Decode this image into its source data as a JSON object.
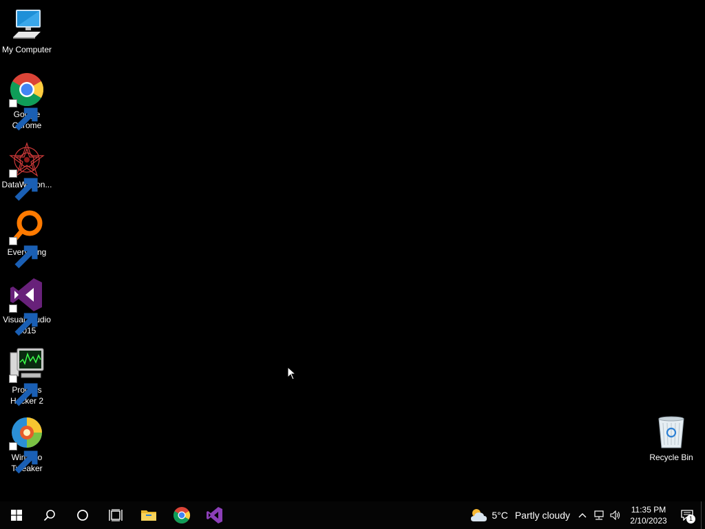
{
  "desktop_icons": [
    {
      "label": "My Computer",
      "icon": "computer-icon"
    },
    {
      "label": "Google Chrome",
      "icon": "chrome-icon"
    },
    {
      "label": "DataWagon...",
      "icon": "datawagon-icon"
    },
    {
      "label": "Everything",
      "icon": "everything-search-icon"
    },
    {
      "label": "Visual Studio 2015",
      "icon": "visual-studio-icon"
    },
    {
      "label": "Process Hacker 2",
      "icon": "process-hacker-icon"
    },
    {
      "label": "Winaero Tweaker",
      "icon": "winaero-tweaker-icon"
    }
  ],
  "recycle_bin": {
    "label": "Recycle Bin",
    "icon": "recycle-bin-icon"
  },
  "taskbar": {
    "start": "windows-start-icon",
    "search": "search-icon",
    "cortana": "cortana-icon",
    "task_view": "task-view-icon",
    "pinned": [
      "file-explorer-icon",
      "chrome-icon",
      "visual-studio-icon"
    ],
    "weather": {
      "temp": "5°C",
      "desc": "Partly cloudy",
      "icon": "partly-cloudy-icon"
    },
    "tray": [
      "show-hidden-icons-chevron",
      "network-icon",
      "volume-icon"
    ],
    "clock": {
      "time": "11:35 PM",
      "date": "2/10/2023"
    },
    "notifications": {
      "icon": "action-center-icon",
      "count": "1"
    }
  },
  "colors": {
    "background": "#000000",
    "taskbar": "#050505",
    "accent": "#76b9ed"
  }
}
